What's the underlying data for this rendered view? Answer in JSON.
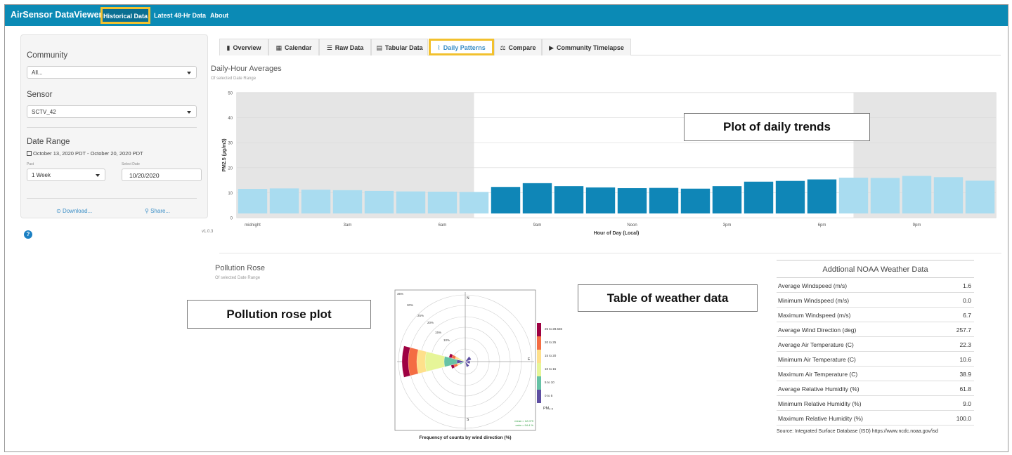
{
  "app": {
    "brand": "AirSensor DataViewer",
    "nav": [
      "Historical Data",
      "Latest 48-Hr Data",
      "About"
    ],
    "version": "v1.0.3"
  },
  "sidebar": {
    "community_label": "Community",
    "community_value": "All...",
    "sensor_label": "Sensor",
    "sensor_value": "SCTV_42",
    "date_range_label": "Date Range",
    "date_range_text": "October 13, 2020 PDT - October 20, 2020 PDT",
    "past_label": "Past",
    "past_value": "1 Week",
    "select_date_label": "Select Date",
    "select_date_value": "10/20/2020",
    "download": "Download...",
    "share": "Share..."
  },
  "tabs": [
    {
      "label": "Overview",
      "icon": "chart-icon"
    },
    {
      "label": "Calendar",
      "icon": "calendar-icon"
    },
    {
      "label": "Raw Data",
      "icon": "database-icon"
    },
    {
      "label": "Tabular Data",
      "icon": "table-icon"
    },
    {
      "label": "Daily Patterns",
      "icon": "line-chart-icon",
      "active": true
    },
    {
      "label": "Compare",
      "icon": "balance-icon"
    },
    {
      "label": "Community Timelapse",
      "icon": "video-icon"
    }
  ],
  "daily": {
    "title": "Daily-Hour Averages",
    "subtitle": "Of selected Date Range"
  },
  "chart_data": {
    "type": "bar",
    "title": "",
    "xlabel": "Hour of Day (Local)",
    "ylabel": "PM2.5 (µg/m3)",
    "ylim": [
      0,
      50
    ],
    "yticks": [
      0,
      10,
      20,
      30,
      40,
      50
    ],
    "xtick_labels": [
      "midnight",
      "3am",
      "6am",
      "9am",
      "Noon",
      "3pm",
      "6pm",
      "9pm"
    ],
    "categories": [
      "0",
      "1",
      "2",
      "3",
      "4",
      "5",
      "6",
      "7",
      "8",
      "9",
      "10",
      "11",
      "12",
      "13",
      "14",
      "15",
      "16",
      "17",
      "18",
      "19",
      "20",
      "21",
      "22",
      "23"
    ],
    "values": [
      11.5,
      11.7,
      11.2,
      11.0,
      10.7,
      10.5,
      10.4,
      10.3,
      12.3,
      13.8,
      12.6,
      12.1,
      11.8,
      11.9,
      11.6,
      12.6,
      14.4,
      14.7,
      15.3,
      16.0,
      15.9,
      16.7,
      16.2,
      14.8
    ],
    "night_shading": [
      [
        0,
        7.5
      ],
      [
        19.5,
        24
      ]
    ],
    "colors": {
      "night_bar": "#a9dcf0",
      "day_bar": "#0f86b7",
      "shade": "#e5e5e5",
      "panel": "#f2f2f2"
    }
  },
  "rose": {
    "title": "Pollution Rose",
    "subtitle": "Of selected Date Range",
    "caption": "Frequency of counts by wind direction (%)",
    "ring_labels": [
      "30%",
      "25%",
      "20%",
      "15%",
      "10%"
    ],
    "top_label": "35%",
    "compass": {
      "n": "N",
      "e": "E",
      "s": "S"
    },
    "legend": [
      {
        "label": "25 to 28.636",
        "color": "#9e0142"
      },
      {
        "label": "20 to 25",
        "color": "#f46d43"
      },
      {
        "label": "15 to 20",
        "color": "#fee08b"
      },
      {
        "label": "10 to 15",
        "color": "#e6f598"
      },
      {
        "label": "5 to 10",
        "color": "#66c2a5"
      },
      {
        "label": "0 to 5",
        "color": "#5e4fa2"
      }
    ],
    "legend_title": "PM₂.₅",
    "mean_text": "mean = 12.079",
    "calm_text": "calm = 94.4 %"
  },
  "weather": {
    "title": "Addtional NOAA Weather Data",
    "rows": [
      {
        "label": "Average Windspeed (m/s)",
        "value": "1.6"
      },
      {
        "label": "Minimum Windspeed (m/s)",
        "value": "0.0"
      },
      {
        "label": "Maximum Windspeed (m/s)",
        "value": "6.7"
      },
      {
        "label": "Average Wind Direction (deg)",
        "value": "257.7"
      },
      {
        "label": "Average Air Temperature (C)",
        "value": "22.3"
      },
      {
        "label": "Minimum Air Temperature (C)",
        "value": "10.6"
      },
      {
        "label": "Maximum Air Temperature (C)",
        "value": "38.9"
      },
      {
        "label": "Average Relative Humidity (%)",
        "value": "61.8"
      },
      {
        "label": "Minimum Relative Humidity (%)",
        "value": "9.0"
      },
      {
        "label": "Maximum Relative Humidity (%)",
        "value": "100.0"
      }
    ],
    "source": "Source: Integrated Surface Database (ISD) https://www.ncdc.noaa.gov/isd"
  },
  "callouts": {
    "daily": "Plot of daily trends",
    "rose": "Pollution rose plot",
    "table": "Table of weather data"
  }
}
